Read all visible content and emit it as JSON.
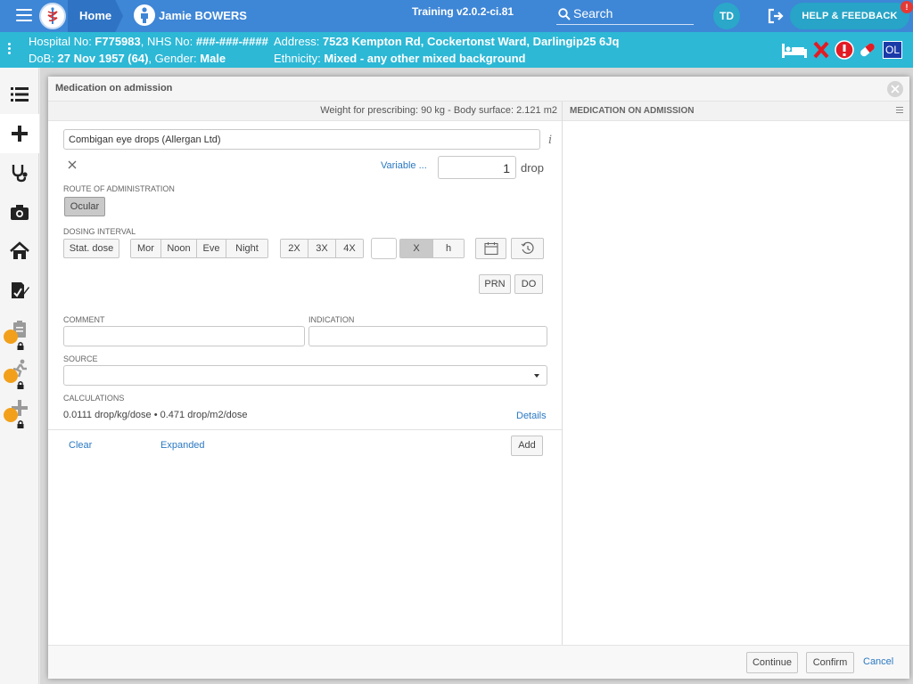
{
  "topbar": {
    "home_label": "Home",
    "patient_name": "Jamie BOWERS",
    "version": "Training v2.0.2-ci.81",
    "search_label": "Search",
    "avatar_initials": "TD",
    "help_label": "HELP & FEEDBACK",
    "help_badge": "!"
  },
  "banner": {
    "hospital_label": "Hospital No: ",
    "hospital_no": "F775983",
    "nhs_label": ", NHS No: ",
    "nhs_no": "###-###-####",
    "dob_label": "DoB: ",
    "dob": "27 Nov 1957 (64)",
    "gender_label": ", Gender: ",
    "gender": "Male",
    "address_label": "Address: ",
    "address": "7523 Kempton Rd, Cockertonst Ward, Darlingip25 6Jq",
    "ethnicity_label": "Ethnicity: ",
    "ethnicity": "Mixed - any other mixed background",
    "ol_badge": "OL",
    "colors": {
      "alert_red": "#e31b23"
    }
  },
  "sidebar": {
    "items": [
      {
        "icon": "list-icon"
      },
      {
        "icon": "plus-icon"
      },
      {
        "icon": "stethoscope-icon"
      },
      {
        "icon": "camera-icon"
      },
      {
        "icon": "home-icon"
      },
      {
        "icon": "edit-document-icon"
      },
      {
        "icon": "clipboard-icon",
        "locked": true
      },
      {
        "icon": "running-person-icon",
        "locked": true
      },
      {
        "icon": "add-icon",
        "locked": true
      }
    ]
  },
  "modal": {
    "title": "Medication on admission",
    "weight_text": "Weight for prescribing: 90 kg - Body surface: 2.121 m2",
    "right_title": "MEDICATION ON ADMISSION",
    "drug": "Combigan eye drops (Allergan Ltd)",
    "variable_link": "Variable ...",
    "dose_value": "1",
    "dose_unit": "drop",
    "route_label": "ROUTE OF ADMINISTRATION",
    "route_option": "Ocular",
    "dosing_label": "DOSING INTERVAL",
    "stat_dose": "Stat. dose",
    "times": [
      "Mor",
      "Noon",
      "Eve",
      "Night"
    ],
    "freq": [
      "2X",
      "3X",
      "4X"
    ],
    "interval_x": "X",
    "interval_h": "h",
    "prn": "PRN",
    "do": "DO",
    "comment_label": "COMMENT",
    "indication_label": "INDICATION",
    "source_label": "SOURCE",
    "calc_label": "CALCULATIONS",
    "calc_text": "0.0111 drop/kg/dose • 0.471 drop/m2/dose",
    "details_link": "Details",
    "clear_link": "Clear",
    "expanded_link": "Expanded",
    "add_button": "Add",
    "continue_button": "Continue",
    "confirm_button": "Confirm",
    "cancel_link": "Cancel"
  }
}
